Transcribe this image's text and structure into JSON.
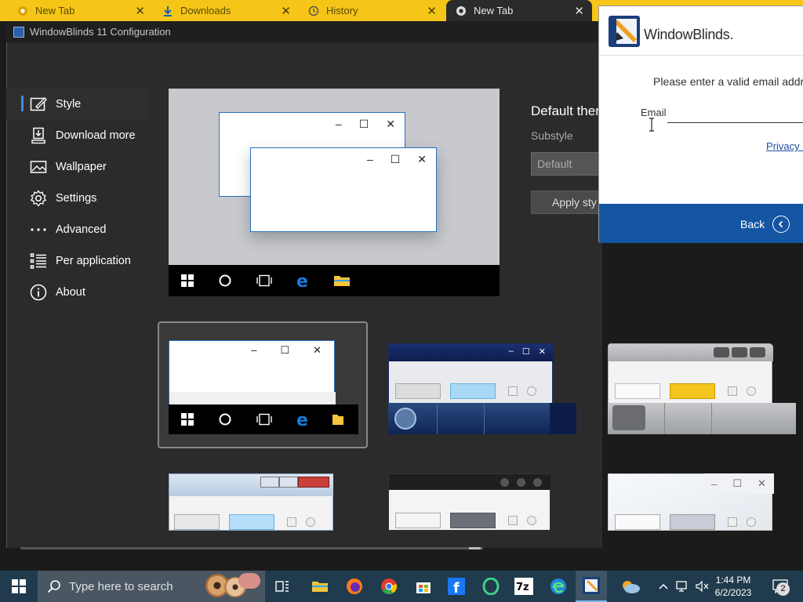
{
  "browser": {
    "tabs": [
      {
        "label": "New Tab",
        "icon": "chrome-icon"
      },
      {
        "label": "Downloads",
        "icon": "download-icon"
      },
      {
        "label": "History",
        "icon": "history-icon"
      },
      {
        "label": "New Tab",
        "icon": "chrome-icon",
        "active": true
      }
    ],
    "close_glyph": "✕"
  },
  "config": {
    "title": "WindowBlinds 11 Configuration",
    "nav": [
      {
        "label": "Style",
        "icon": "pen-icon",
        "selected": true
      },
      {
        "label": "Download more",
        "icon": "download-icon"
      },
      {
        "label": "Wallpaper",
        "icon": "image-icon"
      },
      {
        "label": "Settings",
        "icon": "gear-icon"
      },
      {
        "label": "Advanced",
        "icon": "more-dots-icon"
      },
      {
        "label": "Per application",
        "icon": "list-icon"
      },
      {
        "label": "About",
        "icon": "info-icon"
      }
    ],
    "default_theme_label": "Default ther",
    "substyle_label": "Substyle",
    "substyle_value": "Default",
    "apply_label": "Apply sty"
  },
  "dialog": {
    "brand": "WindowBlinds.",
    "message": "Please enter a valid email addre",
    "email_label": "Email",
    "email_value": "",
    "privacy_link": "Privacy P",
    "back_label": "Back"
  },
  "taskbar": {
    "search_placeholder": "Type here to search",
    "time": "1:44 PM",
    "date": "6/2/2023",
    "notification_count": "2"
  },
  "colors": {
    "browser_tabstrip": "#f5c518",
    "accent_blue": "#1556a3",
    "taskbar": "#1f3b4d"
  }
}
